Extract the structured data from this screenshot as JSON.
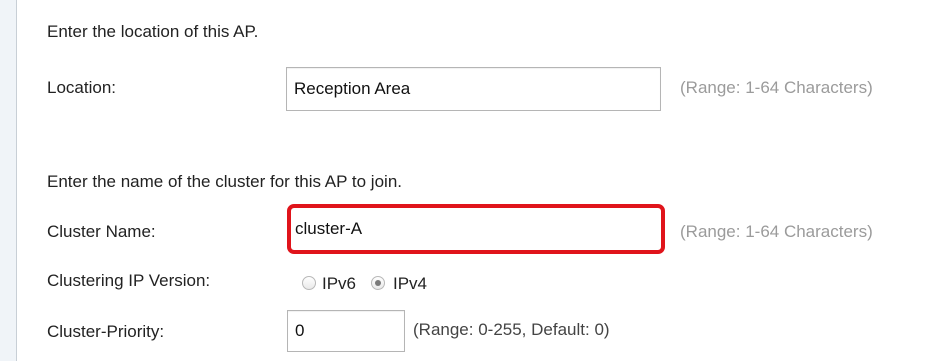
{
  "location_section": {
    "instruction": "Enter the location of this AP.",
    "label": "Location:",
    "value": "Reception Area",
    "hint": "(Range: 1-64 Characters)"
  },
  "cluster_section": {
    "instruction": "Enter the name of the cluster for this AP to join.",
    "name_label": "Cluster Name:",
    "name_value": "cluster-A",
    "name_hint": "(Range: 1-64 Characters)",
    "ip_version_label": "Clustering IP Version:",
    "ip_options": [
      {
        "label": "IPv6",
        "selected": false
      },
      {
        "label": "IPv4",
        "selected": true
      }
    ],
    "priority_label": "Cluster-Priority:",
    "priority_value": "0",
    "priority_hint": "(Range: 0-255, Default: 0)"
  },
  "colors": {
    "highlight": "#e0141b",
    "hint": "#9b9b9b",
    "background": "#f0f4f8"
  }
}
